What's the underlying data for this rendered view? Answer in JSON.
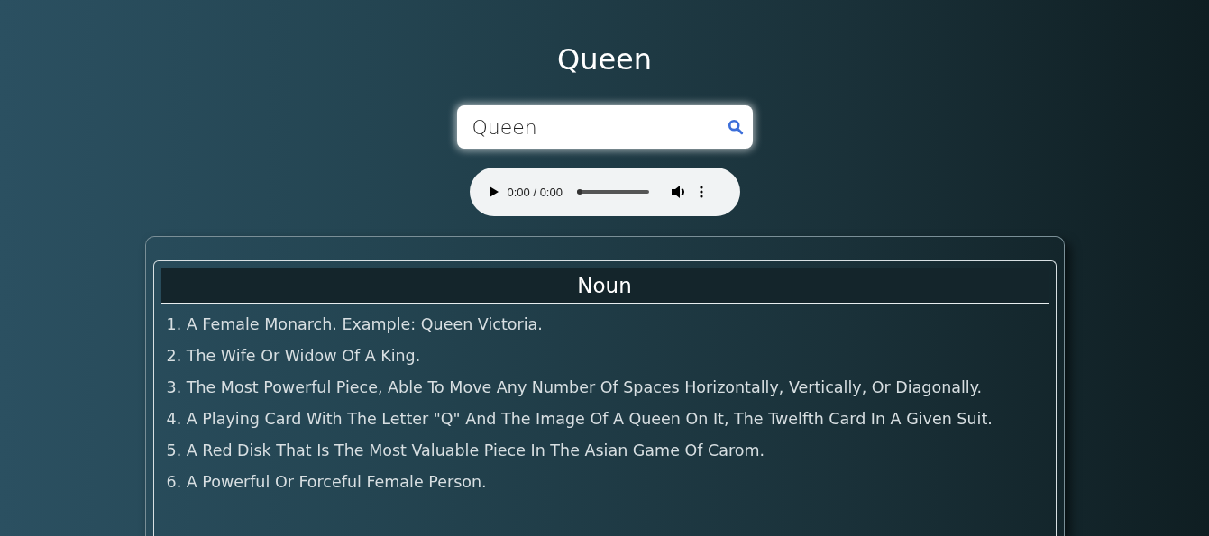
{
  "title": "Queen",
  "search": {
    "value": "Queen"
  },
  "audio": {
    "time": "0:00 / 0:00",
    "level": 0
  },
  "meanings": [
    {
      "part_of_speech": "Noun",
      "definitions": [
        "1. A Female Monarch. Example: Queen Victoria.",
        "2. The Wife Or Widow Of A King.",
        "3. The Most Powerful Piece, Able To Move Any Number Of Spaces Horizontally, Vertically, Or Diagonally.",
        "4. A Playing Card With The Letter \"Q\" And The Image Of A Queen On It, The Twelfth Card In A Given Suit.",
        "5. A Red Disk That Is The Most Valuable Piece In The Asian Game Of Carom.",
        "6. A Powerful Or Forceful Female Person."
      ]
    }
  ]
}
